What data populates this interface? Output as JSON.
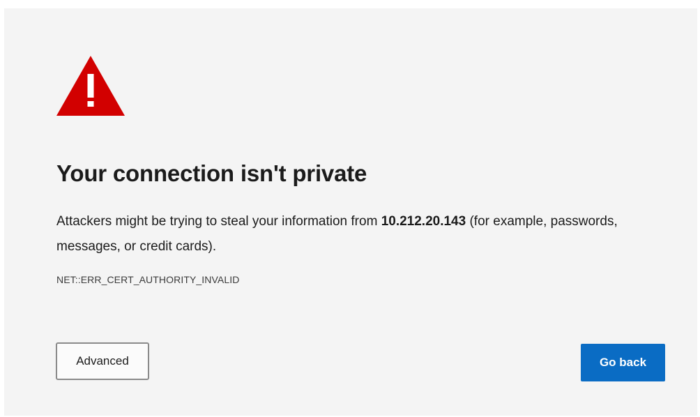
{
  "interstitial": {
    "icon": "warning-triangle-icon",
    "icon_color": "#d20000",
    "title": "Your connection isn't private",
    "description": {
      "before": "Attackers might be trying to steal your information from ",
      "host": "10.212.20.143",
      "after": " (for example, passwords, messages, or credit cards)."
    },
    "error_code": "NET::ERR_CERT_AUTHORITY_INVALID"
  },
  "buttons": {
    "advanced_label": "Advanced",
    "go_back_label": "Go back",
    "primary_color": "#0a6cc4"
  }
}
